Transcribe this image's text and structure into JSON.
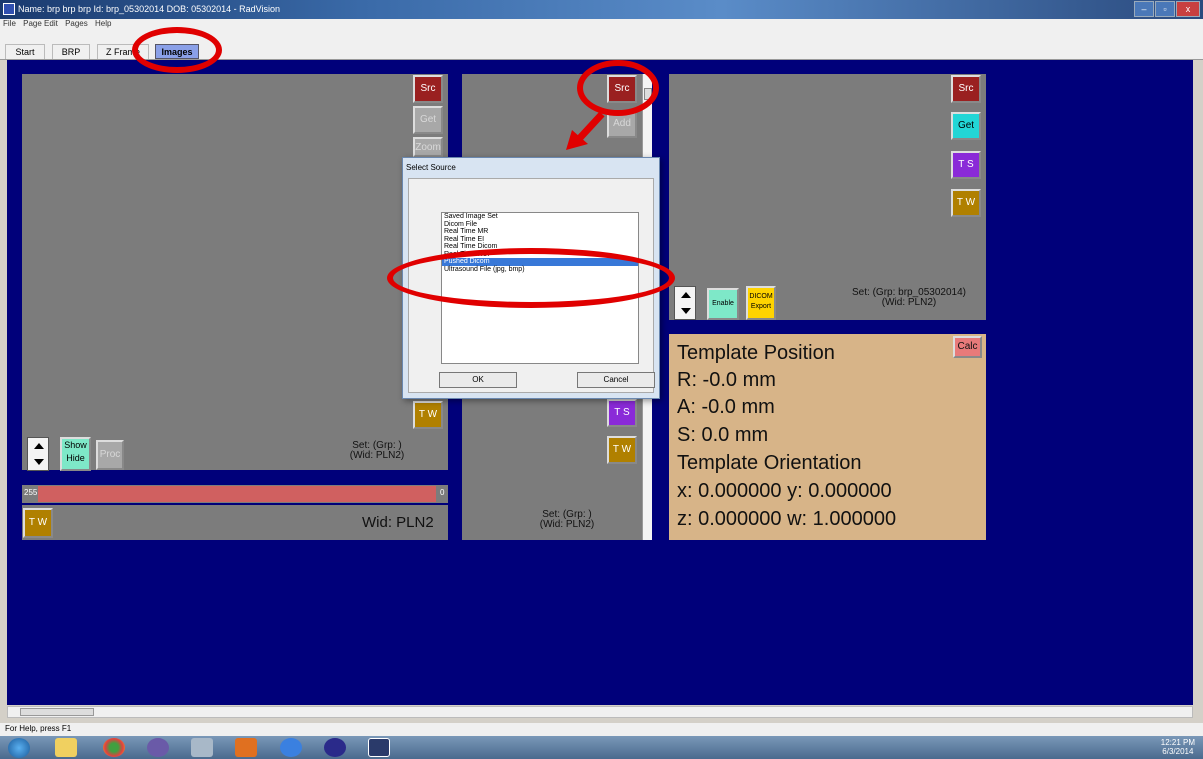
{
  "window": {
    "title": "Name: brp brp brp   Id: brp_05302014   DOB: 05302014 - RadVision"
  },
  "menu": [
    "File",
    "Page Edit",
    "Pages",
    "Help"
  ],
  "tabs": [
    "Start",
    "BRP",
    "Z Frame",
    "Images"
  ],
  "panels": {
    "left": {
      "buttons": {
        "src": "Src",
        "get": "Get",
        "zoom": "Zoom",
        "tw": "T W",
        "show": "Show",
        "hide": "Hide",
        "proc": "Proc"
      },
      "set_line1": "Set:  (Grp: )",
      "set_line2": "(Wid: PLN2)",
      "slider_min": "255",
      "slider_max": "0",
      "slider_fill": 0.97,
      "tw": "T W",
      "wid": "Wid: PLN2"
    },
    "middle": {
      "buttons": {
        "src": "Src",
        "add": "Add",
        "ts": "T S",
        "tw": "T W"
      },
      "set_line1": "Set:  (Grp: )",
      "set_line2": "(Wid: PLN2)"
    },
    "right": {
      "buttons": {
        "src": "Src",
        "get": "Get",
        "ts": "T S",
        "tw": "T W",
        "enable": "Enable",
        "dicom": "DICOM",
        "export": "Export"
      },
      "set_line1": "Set:  (Grp: brp_05302014)",
      "set_line2": "(Wid: PLN2)"
    }
  },
  "template": {
    "position_title": "Template Position",
    "r": "R: -0.0  mm",
    "a": "A: -0.0  mm",
    "s": "S: 0.0  mm",
    "orientation_title": "Template Orientation",
    "xy": "x: 0.000000  y: 0.000000",
    "zw": "z: 0.000000  w: 1.000000",
    "calc": "Calc"
  },
  "dialog": {
    "title": "Select Source",
    "items": [
      "Saved Image Set",
      "Dicom File",
      "Real Time MR",
      "Real Time EI",
      "Real Time Dicom",
      "Real Time RUF",
      "Pushed Dicom",
      "Ultrasound File (jpg, bmp)"
    ],
    "selected": "Pushed Dicom",
    "ok": "OK",
    "cancel": "Cancel"
  },
  "status": "For Help, press F1",
  "clock": {
    "time": "12:21 PM",
    "date": "6/3/2014"
  },
  "colors": {
    "workspace": "#00007a",
    "panel": "#7c7c7c",
    "annotation": "#e00000",
    "template_bg": "#d7b488"
  }
}
